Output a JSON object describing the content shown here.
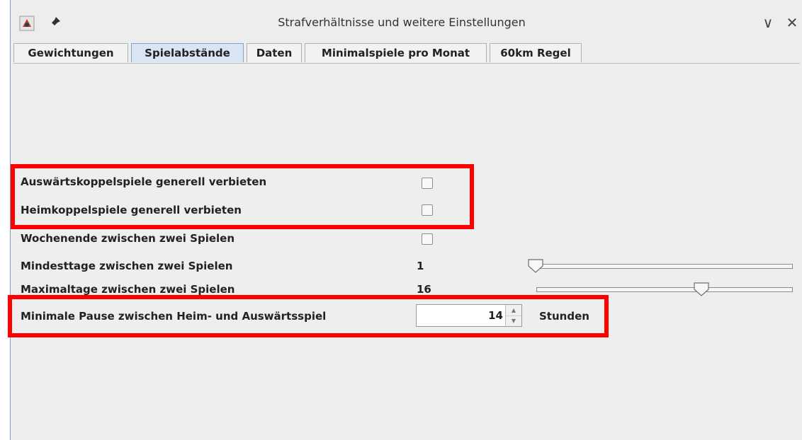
{
  "window": {
    "title": "Strafverhältnisse und weitere Einstellungen",
    "controls": {
      "minimize": "∨",
      "close": "✕"
    }
  },
  "tabs": [
    {
      "label": "Gewichtungen",
      "active": false
    },
    {
      "label": "Spielabstände",
      "active": true
    },
    {
      "label": "Daten",
      "active": false
    },
    {
      "label": "Minimalspiele pro Monat",
      "active": false
    },
    {
      "label": "60km Regel",
      "active": false
    }
  ],
  "settings": {
    "away_double": {
      "label": "Auswärtskoppelspiele generell verbieten",
      "checked": false
    },
    "home_double": {
      "label": "Heimkoppelspiele generell verbieten",
      "checked": false
    },
    "weekend": {
      "label": "Wochenende zwischen zwei Spielen",
      "checked": false
    },
    "min_days": {
      "label": "Mindesttage zwischen zwei Spielen",
      "value": "1"
    },
    "max_days": {
      "label": "Maximaltage zwischen zwei Spielen",
      "value": "16"
    },
    "min_pause": {
      "label": "Minimale Pause zwischen Heim- und Auswärtsspiel",
      "value": "14",
      "unit": "Stunden"
    }
  },
  "icons": {
    "app": "java-app-icon",
    "pin": "pin-icon",
    "spin_up": "▲",
    "spin_down": "▼"
  },
  "colors": {
    "highlight": "#ff0000",
    "active_tab": "#d9e5f3",
    "background": "#eeeeee"
  }
}
